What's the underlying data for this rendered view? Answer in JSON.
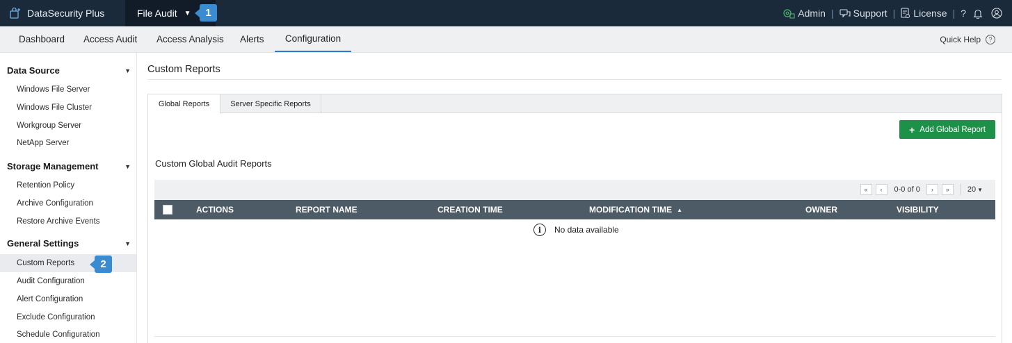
{
  "topbar": {
    "brand": "DataSecurity Plus",
    "product": "File Audit",
    "right": {
      "admin": "Admin",
      "support": "Support",
      "license": "License",
      "help": "?"
    }
  },
  "badges": {
    "one": "1",
    "two": "2"
  },
  "nav": {
    "tabs": [
      "Dashboard",
      "Access Audit",
      "Access Analysis",
      "Alerts",
      "Configuration"
    ],
    "active": "Configuration",
    "quick_help": "Quick Help"
  },
  "sidebar": {
    "sections": [
      {
        "title": "Data Source",
        "items": [
          "Windows File Server",
          "Windows File Cluster",
          "Workgroup Server",
          "NetApp Server"
        ]
      },
      {
        "title": "Storage Management",
        "items": [
          "Retention Policy",
          "Archive Configuration",
          "Restore Archive Events"
        ]
      },
      {
        "title": "General Settings",
        "items": [
          "Custom Reports",
          "Audit Configuration",
          "Alert Configuration",
          "Exclude Configuration",
          "Schedule Configuration"
        ]
      }
    ],
    "active_item": "Custom Reports"
  },
  "main": {
    "title": "Custom Reports",
    "tabs": [
      "Global Reports",
      "Server Specific Reports"
    ],
    "active_tab": "Global Reports",
    "add_button": "Add Global Report",
    "section_title": "Custom Global Audit Reports",
    "pager": {
      "range": "0-0 of 0",
      "page_size": "20"
    },
    "columns": [
      "ACTIONS",
      "REPORT NAME",
      "CREATION TIME",
      "MODIFICATION TIME",
      "OWNER",
      "VISIBILITY"
    ],
    "sorted_column": "MODIFICATION TIME",
    "empty_message": "No data available"
  },
  "colors": {
    "topbar": "#1b2a3a",
    "accent": "#2d7bd0",
    "add_button": "#1e9148",
    "table_header": "#4d5b66",
    "badge": "#3b8bd0"
  }
}
